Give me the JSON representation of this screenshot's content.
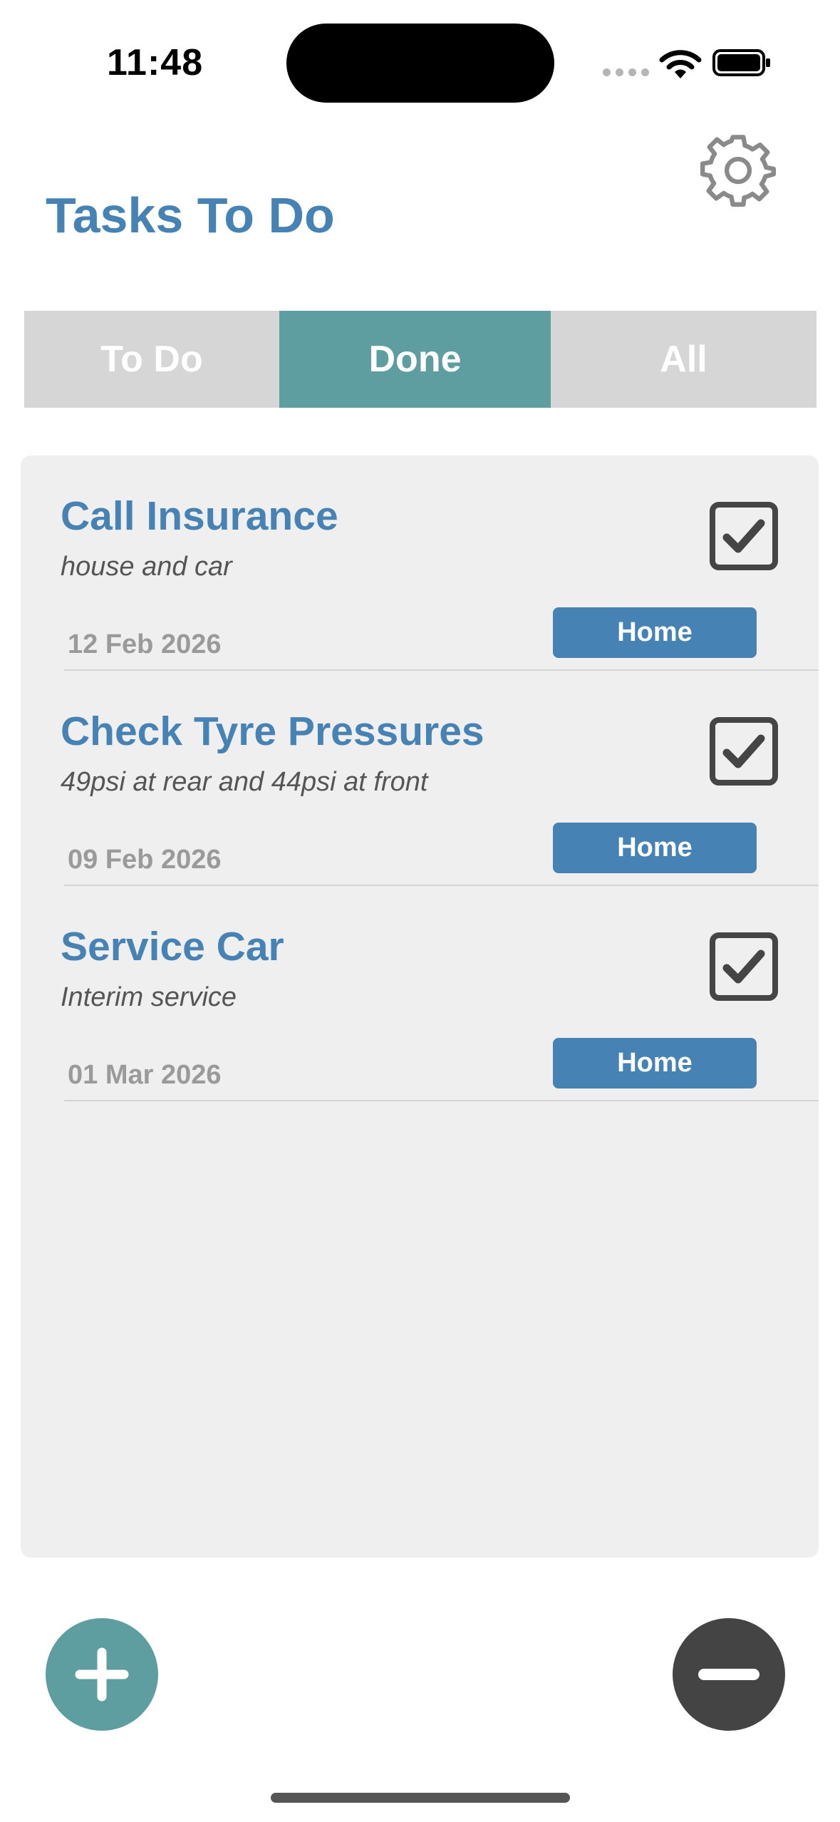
{
  "status_bar": {
    "time": "11:48"
  },
  "header": {
    "title": "Tasks To Do",
    "settings_icon": "gear-icon"
  },
  "filter_tabs": [
    {
      "label": "To Do",
      "selected": false
    },
    {
      "label": "Done",
      "selected": true
    },
    {
      "label": "All",
      "selected": false
    }
  ],
  "tasks": [
    {
      "title": "Call Insurance",
      "note": "house and car",
      "date": "12 Feb 2026",
      "tag": "Home",
      "done": true
    },
    {
      "title": "Check Tyre Pressures",
      "note": "49psi at rear and 44psi at front",
      "date": "09 Feb 2026",
      "tag": "Home",
      "done": true
    },
    {
      "title": "Service Car",
      "note": "Interim service",
      "date": "01 Mar 2026",
      "tag": "Home",
      "done": true
    }
  ],
  "actions": {
    "add_icon": "plus-icon",
    "remove_icon": "minus-icon"
  },
  "colors": {
    "accent_blue": "#4682b4",
    "accent_teal": "#5f9ea0",
    "tab_inactive": "#d6d6d6",
    "panel_bg": "#efefef",
    "remove_button": "#444444"
  }
}
